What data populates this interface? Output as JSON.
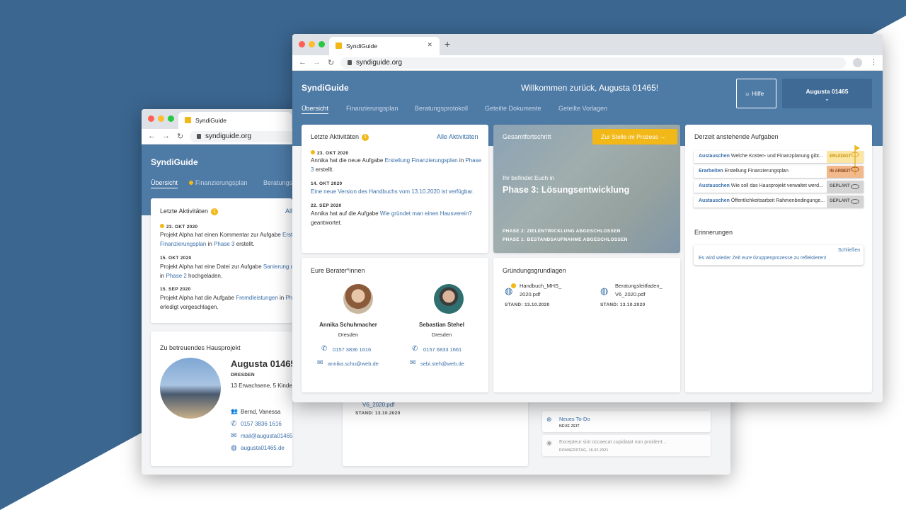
{
  "browser": {
    "tab_title": "SyndiGuide",
    "url": "syndiguide.org"
  },
  "app": {
    "brand": "SyndiGuide",
    "welcome": "Willkommen zurück, Augusta 01465!",
    "help": "Hilfe",
    "user": "Augusta 01465"
  },
  "nav": [
    "Übersicht",
    "Finanzierungsplan",
    "Beratungsprotokoll",
    "Geteilte Dokumente",
    "Geteilte Vorlagen"
  ],
  "back_nav": [
    "Übersicht",
    "Finanzierungsplan",
    "Beratungs"
  ],
  "activities": {
    "title": "Letzte Aktivitäten",
    "count": "1",
    "all": "Alle Aktivitäten",
    "items": [
      {
        "date": "23. OKT 2020",
        "p1": "Annika hat die neue Aufgabe ",
        "l1": "Erstellung Finanzierungsplan",
        "p2": " in ",
        "l2": "Phase 3",
        "p3": " erstellt."
      },
      {
        "date": "14. OKT 2020",
        "l1": "Eine neue Version des Handbuchs vom 13.10.2020 ist verfügbar."
      },
      {
        "date": "22. SEP 2020",
        "p1": "Annika hat auf die Aufgabe ",
        "l1": "Wie gründet man einen Hausverein?",
        "p2": " geantwortet."
      }
    ]
  },
  "progress": {
    "title": "Gesamtfortschritt",
    "button": "Zur Stelle im Prozess →",
    "sub": "Ihr befindet Euch in",
    "phase": "Phase 3: Lösungsentwicklung",
    "done": [
      "PHASE 2: ZIELENTWICKLUNG ABGESCHLOSSEN",
      "PHASE 1: BESTANDSAUFNAHME ABGESCHLOSSEN"
    ]
  },
  "tasks": {
    "title": "Derzeit anstehende Aufgaben",
    "items": [
      {
        "verb": "Austauschen",
        "text": " Welche Kosten- und Finanzplanung gibt...",
        "status": "ERLEDIGT",
        "color": "#fbe6a3",
        "fg": "#c8930a"
      },
      {
        "verb": "Erarbeiten",
        "text": " Erstellung Finanzierungsplan",
        "status": "IN ARBEIT",
        "color": "#f1b98c",
        "fg": "#8a4a1d"
      },
      {
        "verb": "Austauschen",
        "text": " Wie soll das Hausprojekt verwaltet werd...",
        "status": "GEPLANT",
        "color": "#d4d4d4",
        "fg": "#555"
      },
      {
        "verb": "Austauschen",
        "text": " Öffentlichkeitsarbeit Rahmenbedingunge...",
        "status": "GEPLANT",
        "color": "#d4d4d4",
        "fg": "#555"
      }
    ]
  },
  "reminders": {
    "title": "Erinnerungen",
    "close": "Schließen",
    "text": "Es wird wieder Zeit eure Gruppenprozesse zu reflektieren!"
  },
  "advisors": {
    "title": "Eure Berater*innen",
    "people": [
      {
        "name": "Annika Schuhmacher",
        "city": "Dresden",
        "phone": "0157 3836 1616",
        "email": "annika.schu@web.de"
      },
      {
        "name": "Sebastian Stehel",
        "city": "Dresden",
        "phone": "0157 6833 1661",
        "email": "sebi.steh@web.de"
      }
    ]
  },
  "docs": {
    "title": "Gründungsgrundlagen",
    "files": [
      {
        "name": "Handbuch_MHS_\n2020.pdf",
        "stand": "STAND: 13.10.2020"
      },
      {
        "name": "Beratungsleitfaden_\nV6_2020.pdf",
        "stand": "STAND: 13.10.2020"
      }
    ]
  },
  "back": {
    "activities": [
      {
        "date": "23. OKT 2020",
        "p1": "Projekt Alpha hat einen Kommentar zur Aufgabe ",
        "l1": "Erste",
        "l2": "Finanzierungsplan",
        "p2": " in ",
        "l3": "Phase 3",
        "p3": " erstellt."
      },
      {
        "date": "15. OKT 2020",
        "p1": "Projekt Alpha hat eine Datei zur Aufgabe ",
        "l1": "Sanierung o",
        "p2": "in ",
        "l2": "Phase 2",
        "p3": " hochgeladen."
      },
      {
        "date": "15. SEP 2020",
        "p1": "Projekt Alpha hat die Aufgabe ",
        "l1": "Fremdleistungen",
        "p2": " in ",
        "l2": "Pha",
        "p3": "erledigt vorgeschlagen."
      }
    ],
    "all": "All",
    "project_title": "Zu betreuendes Hausprojekt",
    "project_name": "Augusta 01465",
    "project_city": "DRESDEN",
    "project_size": "13 Erwachsene, 5 Kinder",
    "people": "Bernd, Vanessa",
    "phone": "0157 3836 1616",
    "email": "mail@augusta01465.de",
    "web": "augusta01465.de",
    "doc": "V6_2020.pdf",
    "doc_stand": "STAND: 13.10.2020",
    "todo": "Neues To-Do",
    "todo_sub": "NEUE ZEIT",
    "note": "Excepteur sint occaecat cupidatat non proident...",
    "note_date": "DONNERSTAG, 18.02.2021"
  }
}
